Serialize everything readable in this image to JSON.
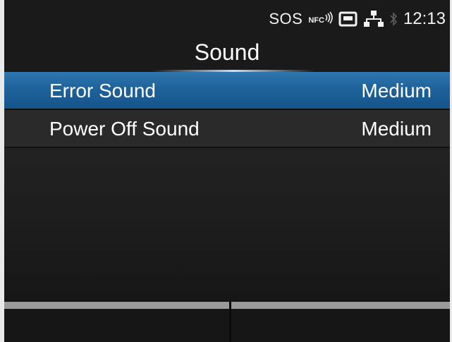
{
  "status_bar": {
    "sos_label": "SOS",
    "nfc_label": "NFC",
    "time": "12:13",
    "icons": [
      "nfc-icon",
      "sd-card-icon",
      "network-icon",
      "bluetooth-icon"
    ]
  },
  "header": {
    "title": "Sound"
  },
  "settings": [
    {
      "label": "Error Sound",
      "value": "Medium",
      "selected": true
    },
    {
      "label": "Power Off Sound",
      "value": "Medium",
      "selected": false
    }
  ],
  "softkeys": {
    "left_label": "",
    "right_label": ""
  },
  "colors": {
    "background": "#1a1a1a",
    "selection": "#1f629b",
    "softkey_strip": "#9a9a9a",
    "frame": "#e9e9e9"
  }
}
